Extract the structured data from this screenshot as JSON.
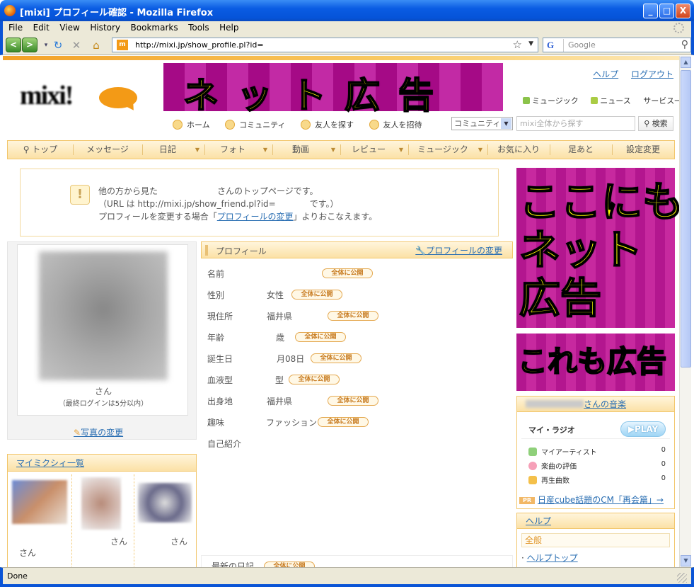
{
  "window": {
    "title": "[mixi] プロフィール確認 - Mozilla Firefox",
    "minimize": "_",
    "maximize": "□",
    "close": "X"
  },
  "menu": [
    "File",
    "Edit",
    "View",
    "History",
    "Bookmarks",
    "Tools",
    "Help"
  ],
  "navbar": {
    "back": "<",
    "forward": ">",
    "url": "http://mixi.jp/show_profile.pl?id=",
    "favicon_text": "m",
    "search_engine": "G",
    "search_placeholder": "Google"
  },
  "header": {
    "logo_text": "mixi!",
    "banner_text": "ネット広告",
    "links": {
      "help": "ヘルプ",
      "logout": "ログアウト"
    },
    "service_links": [
      "ミュージック",
      "ニュース",
      "サービス一覧"
    ],
    "subnav": [
      "ホーム",
      "コミュニティ",
      "友人を探す",
      "友人を招待"
    ],
    "search_scope": "コミュニティ",
    "search_placeholder": "mixi全体から探す",
    "search_button": "検索"
  },
  "mainnav": [
    "トップ",
    "メッセージ",
    "日記",
    "フォト",
    "動画",
    "レビュー",
    "ミュージック",
    "お気に入り",
    "足あと",
    "設定変更"
  ],
  "notice": {
    "icon": "!",
    "line1": "他の方から見た　　　　　　　さんのトップページです。",
    "line2": "（URL は http://mixi.jp/show_friend.pl?id=　　　　です。）",
    "line3_before": "プロフィールを変更する場合「",
    "line3_link": "プロフィールの変更",
    "line3_after": "」よりおこなえます。"
  },
  "photo": {
    "name_suffix": "さん",
    "last_login": "（最終ログインは5分以内）",
    "change_link": "写真の変更"
  },
  "mymixi": {
    "title": "マイミクシィ一覧",
    "friends": [
      "さん",
      "さん",
      "さん"
    ]
  },
  "profile": {
    "title": "プロフィール",
    "edit_link": "プロフィールの変更",
    "public_label": "全体に公開",
    "rows": [
      {
        "label": "名前",
        "value": ""
      },
      {
        "label": "性別",
        "value": "女性"
      },
      {
        "label": "現住所",
        "value": "福井県"
      },
      {
        "label": "年齢",
        "value": "歳"
      },
      {
        "label": "誕生日",
        "value": "月08日"
      },
      {
        "label": "血液型",
        "value": "型"
      },
      {
        "label": "出身地",
        "value": "福井県"
      },
      {
        "label": "趣味",
        "value": "ファッション"
      },
      {
        "label": "自己紹介",
        "value": ""
      }
    ],
    "latest_diary": "最新の日記"
  },
  "ads": {
    "ad1_line1": "ここにも",
    "ad1_line2": "ネット",
    "ad1_line3": "広告",
    "ad2": "これも広告"
  },
  "music": {
    "title_suffix": "さんの音楽",
    "radio": "マイ・ラジオ",
    "play": "PLAY",
    "rows": [
      {
        "label": "マイアーティスト",
        "count": "0"
      },
      {
        "label": "楽曲の評価",
        "count": "0"
      },
      {
        "label": "再生曲数",
        "count": "0"
      }
    ],
    "pr_badge": "PR",
    "pr_link": "日産cube話題のCM「再会篇」→"
  },
  "help": {
    "title": "ヘルプ",
    "section": "全般",
    "link": "ヘルプトップ"
  },
  "status": "Done"
}
